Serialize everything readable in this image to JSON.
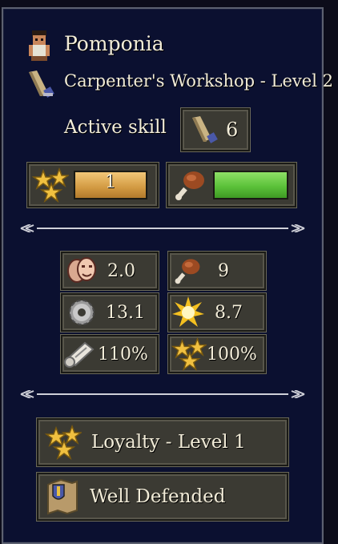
{
  "character": {
    "name": "Pomponia",
    "workshop": "Carpenter's Workshop - Level 2",
    "active_skill_label": "Active skill",
    "active_skill_value": "6"
  },
  "bars": {
    "rank_value": "1",
    "rank_fill": 1.0,
    "food_fill": 1.0
  },
  "stats": [
    {
      "icon": "theater-masks-icon",
      "value": "2.0"
    },
    {
      "icon": "meat-drumstick-icon",
      "value": "9"
    },
    {
      "icon": "gear-icon",
      "value": "13.1"
    },
    {
      "icon": "starburst-icon",
      "value": "8.7"
    },
    {
      "icon": "scroll-icon",
      "value": "110%"
    },
    {
      "icon": "stars-icon",
      "value": "100%"
    }
  ],
  "traits": [
    {
      "icon": "stars-icon",
      "label": "Loyalty - Level 1"
    },
    {
      "icon": "shield-map-icon",
      "label": "Well Defended"
    }
  ],
  "colors": {
    "panel_bg": "#0b1030",
    "rank_bar": "#d9a04a",
    "food_bar": "#5cc23a"
  }
}
